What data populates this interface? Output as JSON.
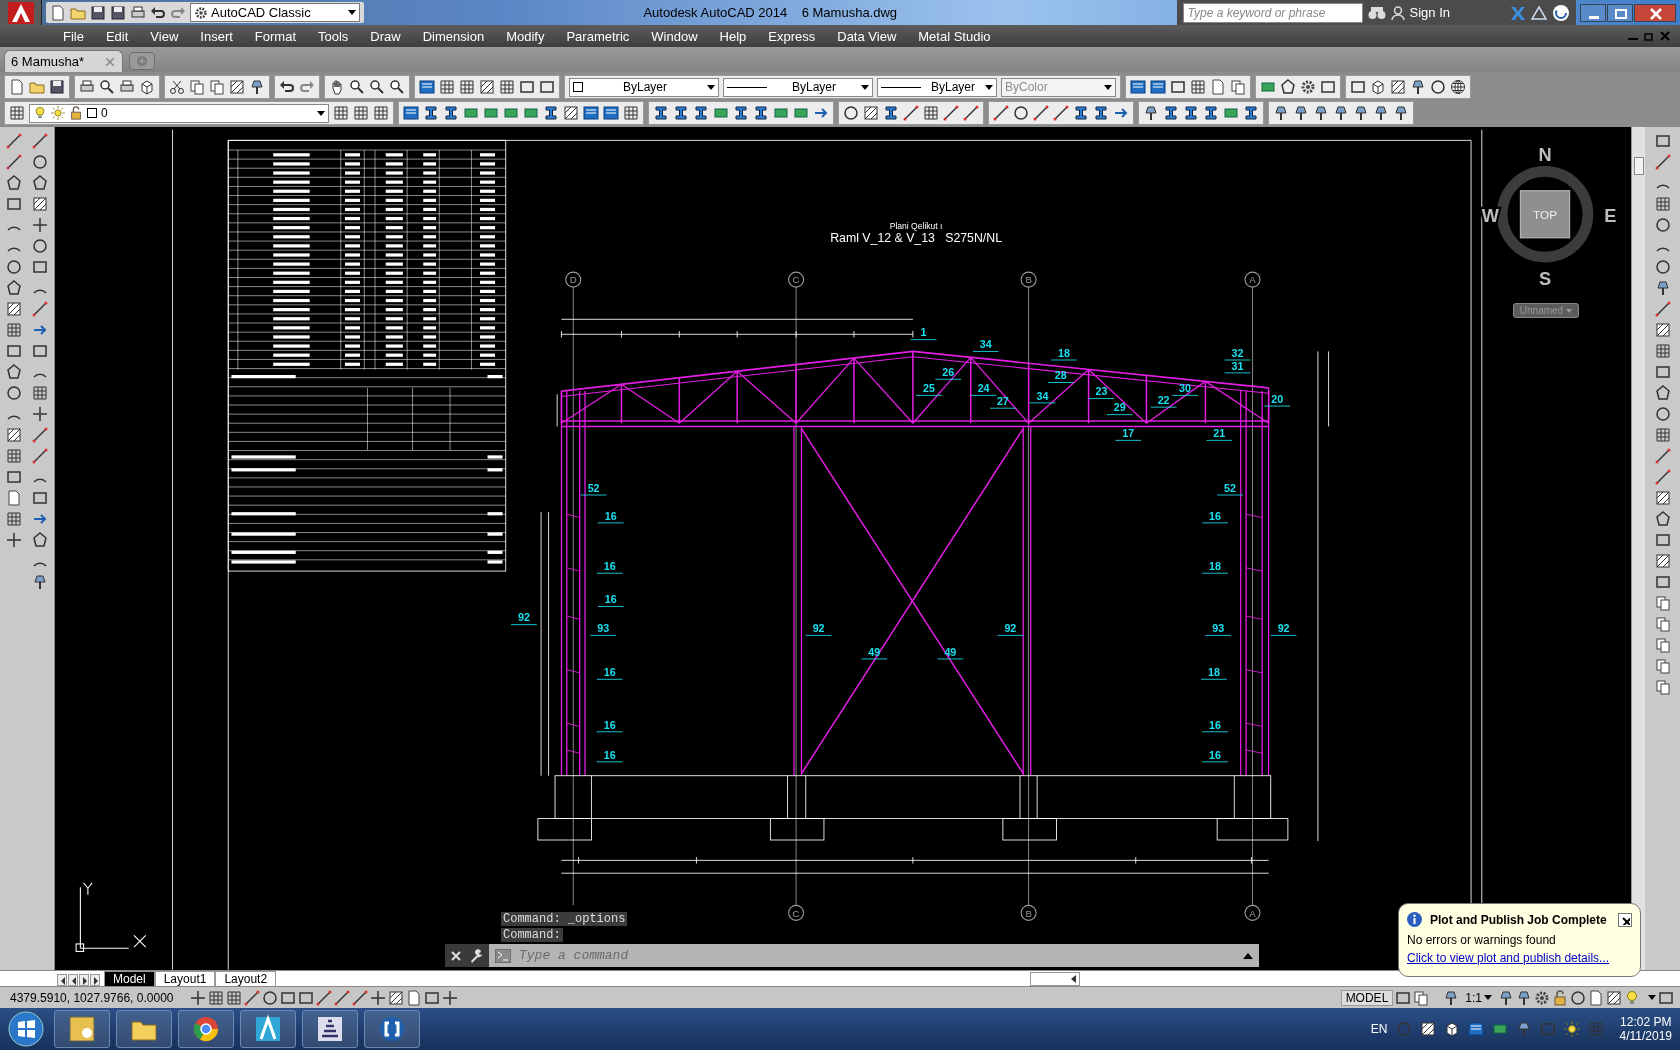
{
  "title_bar": {
    "workspace": "AutoCAD Classic",
    "title": "Autodesk AutoCAD 2014    6 Mamusha.dwg",
    "search": {
      "placeholder": "Type a keyword or phrase"
    },
    "sign_in": "Sign In"
  },
  "menu_bar": [
    "File",
    "Edit",
    "View",
    "Insert",
    "Format",
    "Tools",
    "Draw",
    "Dimension",
    "Modify",
    "Parametric",
    "Window",
    "Help",
    "Express",
    "Data View",
    "Metal Studio"
  ],
  "document_tabs": [
    {
      "label": "6 Mamusha*",
      "selected": true
    }
  ],
  "properties_toolbar": {
    "layer": "0",
    "color_control": "ByLayer",
    "linetype": "ByLayer",
    "lineweight": "ByLayer",
    "plot_style": {
      "value": "ByColor",
      "disabled": true
    }
  },
  "drawing": {
    "subtitle": "Plani Qelikut ı",
    "title": "Raml V_12 & V_13   S275N/NL",
    "grid_bubbles_top": [
      "D",
      "C",
      "B",
      "A"
    ],
    "grid_bubbles_bottom": [
      "C",
      "B",
      "A"
    ],
    "member_labels": [
      "1",
      "34",
      "18",
      "32",
      "31",
      "26",
      "28",
      "25",
      "24",
      "27",
      "34",
      "23",
      "29",
      "22",
      "30",
      "20",
      "17",
      "21",
      "52",
      "52",
      "16",
      "16",
      "16",
      "18",
      "16",
      "92",
      "93",
      "92",
      "92",
      "93",
      "92",
      "49",
      "49",
      "16",
      "18",
      "16",
      "16",
      "16",
      "16"
    ]
  },
  "view_cube": {
    "north": "N",
    "south": "S",
    "east": "E",
    "west": "W",
    "face": "TOP",
    "view": "Unnamed"
  },
  "command_line": {
    "history": [
      "Command: _options",
      "Command:"
    ],
    "placeholder": "Type a command"
  },
  "layout_tabs": [
    {
      "label": "Model",
      "selected": true
    },
    {
      "label": "Layout1",
      "selected": false
    },
    {
      "label": "Layout2",
      "selected": false
    }
  ],
  "status_bar": {
    "coordinates": "4379.5910, 1027.9766, 0.0000",
    "space": "MODEL",
    "annotation_scale": "1:1"
  },
  "notification": {
    "title": "Plot and Publish Job Complete",
    "message": "No errors or warnings found",
    "link": "Click to view plot and publish details..."
  },
  "taskbar": {
    "language": "EN",
    "time": "12:02 PM",
    "date": "4/11/2019"
  }
}
